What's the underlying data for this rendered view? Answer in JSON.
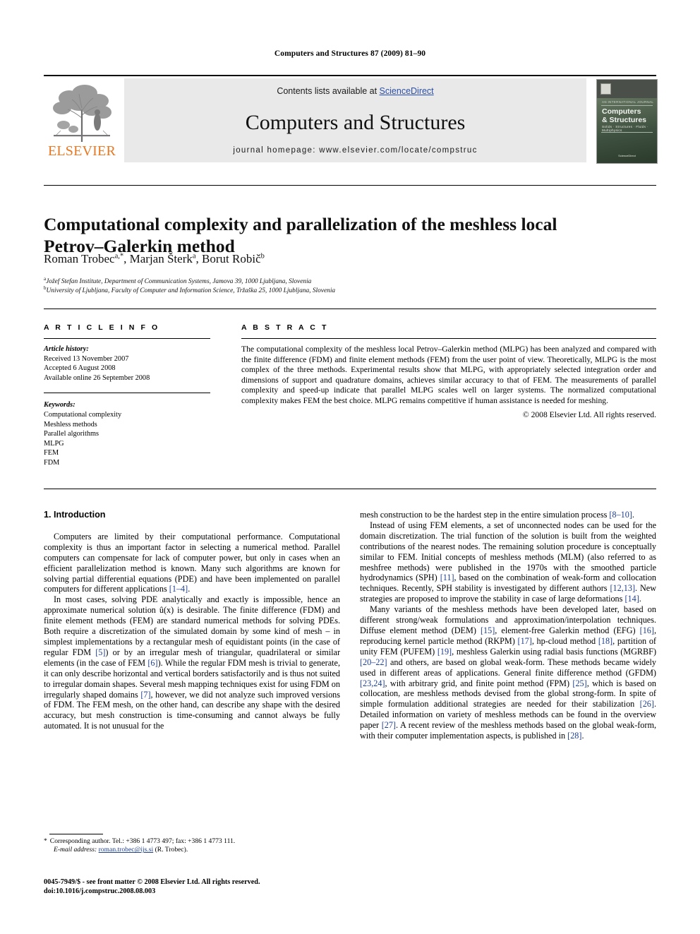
{
  "running_head": "Computers and Structures 87 (2009) 81–90",
  "banner": {
    "contents_prefix": "Contents lists available at ",
    "sciencedirect": "ScienceDirect",
    "journal_title": "Computers and Structures",
    "homepage": "journal homepage: www.elsevier.com/locate/compstruc",
    "publisher_logo_text": "ELSEVIER",
    "accent_orange": "#E87722",
    "link_blue": "#2a4ea8",
    "cover": {
      "pretitle": "AN INTERNATIONAL JOURNAL",
      "line1": "Computers",
      "line2": "& Structures",
      "subtitle": "Solids · Structures · Fluids · Multiphysics",
      "footer": "ScienceDirect"
    }
  },
  "article": {
    "title": "Computational complexity and parallelization of the meshless local Petrov–Galerkin method",
    "authors_html": "Roman Trobec, Marjan Šterk, Borut Robič",
    "authors": [
      {
        "name": "Roman Trobec",
        "marks": "a,*"
      },
      {
        "name": "Marjan Šterk",
        "marks": "a"
      },
      {
        "name": "Borut Robič",
        "marks": "b"
      }
    ],
    "affiliations": [
      {
        "mark": "a",
        "text": "Jožef Stefan Institute, Department of Communication Systems, Jamova 39, 1000 Ljubljana, Slovenia"
      },
      {
        "mark": "b",
        "text": "University of Ljubljana, Faculty of Computer and Information Science, Tržaška 25, 1000 Ljubljana, Slovenia"
      }
    ]
  },
  "article_info": {
    "heading": "A R T I C L E   I N F O",
    "history_label": "Article history:",
    "history": [
      "Received 13 November 2007",
      "Accepted 6 August 2008",
      "Available online 26 September 2008"
    ],
    "keywords_label": "Keywords:",
    "keywords": [
      "Computational complexity",
      "Meshless methods",
      "Parallel algorithms",
      "MLPG",
      "FEM",
      "FDM"
    ]
  },
  "abstract": {
    "heading": "A B S T R A C T",
    "text": "The computational complexity of the meshless local Petrov–Galerkin method (MLPG) has been analyzed and compared with the finite difference (FDM) and finite element methods (FEM) from the user point of view. Theoretically, MLPG is the most complex of the three methods. Experimental results show that MLPG, with appropriately selected integration order and dimensions of support and quadrature domains, achieves similar accuracy to that of FEM. The measurements of parallel complexity and speed-up indicate that parallel MLPG scales well on larger systems. The normalized computational complexity makes FEM the best choice. MLPG remains competitive if human assistance is needed for meshing.",
    "copyright": "© 2008 Elsevier Ltd. All rights reserved."
  },
  "body": {
    "section_heading": "1. Introduction",
    "left_paragraphs": [
      "Computers are limited by their computational performance. Computational complexity is thus an important factor in selecting a numerical method. Parallel computers can compensate for lack of computer power, but only in cases when an efficient parallelization method is known. Many such algorithms are known for solving partial differential equations (PDE) and have been implemented on parallel computers for different applications [1–4].",
      "In most cases, solving PDE analytically and exactly is impossible, hence an approximate numerical solution û(x) is desirable. The finite difference (FDM) and finite element methods (FEM) are standard numerical methods for solving PDEs. Both require a discretization of the simulated domain by some kind of mesh – in simplest implementations by a rectangular mesh of equidistant points (in the case of regular FDM [5]) or by an irregular mesh of triangular, quadrilateral or similar elements (in the case of FEM [6]). While the regular FDM mesh is trivial to generate, it can only describe horizontal and vertical borders satisfactorily and is thus not suited to irregular domain shapes. Several mesh mapping techniques exist for using FDM on irregularly shaped domains [7], however, we did not analyze such improved versions of FDM. The FEM mesh, on the other hand, can describe any shape with the desired accuracy, but mesh construction is time-consuming and cannot always be fully automated. It is not unusual for the"
    ],
    "right_paragraphs": [
      "mesh construction to be the hardest step in the entire simulation process [8–10].",
      "Instead of using FEM elements, a set of unconnected nodes can be used for the domain discretization. The trial function of the solution is built from the weighted contributions of the nearest nodes. The remaining solution procedure is conceptually similar to FEM. Initial concepts of meshless methods (MLM) (also referred to as meshfree methods) were published in the 1970s with the smoothed particle hydrodynamics (SPH) [11], based on the combination of weak-form and collocation techniques. Recently, SPH stability is investigated by different authors [12,13]. New strategies are proposed to improve the stability in case of large deformations [14].",
      "Many variants of the meshless methods have been developed later, based on different strong/weak formulations and approximation/interpolation techniques. Diffuse element method (DEM) [15], element-free Galerkin method (EFG) [16], reproducing kernel particle method (RKPM) [17], hp-cloud method [18], partition of unity FEM (PUFEM) [19], meshless Galerkin using radial basis functions (MGRBF) [20–22] and others, are based on global weak-form. These methods became widely used in different areas of applications. General finite difference method (GFDM) [23,24], with arbitrary grid, and finite point method (FPM) [25], which is based on collocation, are meshless methods devised from the global strong-form. In spite of simple formulation additional strategies are needed for their stabilization [26]. Detailed information on variety of meshless methods can be found in the overview paper [27]. A recent review of the meshless methods based on the global weak-form, with their computer implementation aspects, is published in [28]."
    ]
  },
  "footnote": {
    "marker": "*",
    "line1": "Corresponding author. Tel.: +386 1 4773 497; fax: +386 1 4773 111.",
    "email_label": "E-mail address:",
    "email": "roman.trobec@ijs.si",
    "email_suffix": "(R. Trobec)."
  },
  "imprint": {
    "line1": "0045-7949/$ - see front matter © 2008 Elsevier Ltd. All rights reserved.",
    "line2": "doi:10.1016/j.compstruc.2008.08.003"
  }
}
